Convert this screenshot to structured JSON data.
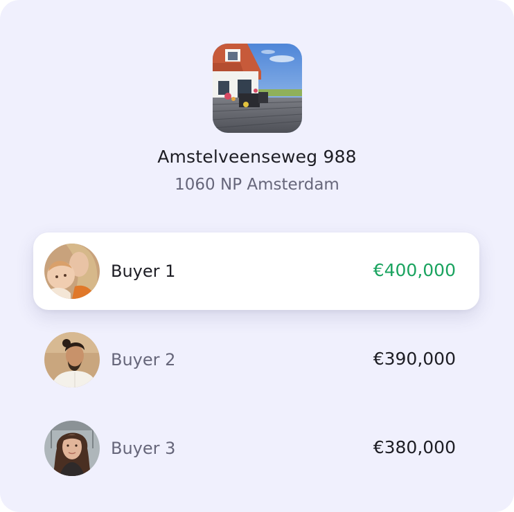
{
  "property": {
    "street": "Amstelveenseweg 988",
    "city": "1060 NP Amsterdam",
    "photo_icon": "house-photo"
  },
  "buyers": [
    {
      "name": "Buyer 1",
      "price": "€400,000",
      "highlighted": true,
      "avatar_icon": "mother-with-child-photo"
    },
    {
      "name": "Buyer 2",
      "price": "€390,000",
      "highlighted": false,
      "avatar_icon": "man-with-bun-photo"
    },
    {
      "name": "Buyer 3",
      "price": "€380,000",
      "highlighted": false,
      "avatar_icon": "woman-long-hair-photo"
    }
  ],
  "colors": {
    "background": "#f0f0fd",
    "highlight_price": "#1aa35f",
    "text_primary": "#1d1d24",
    "text_secondary": "#66667a"
  }
}
